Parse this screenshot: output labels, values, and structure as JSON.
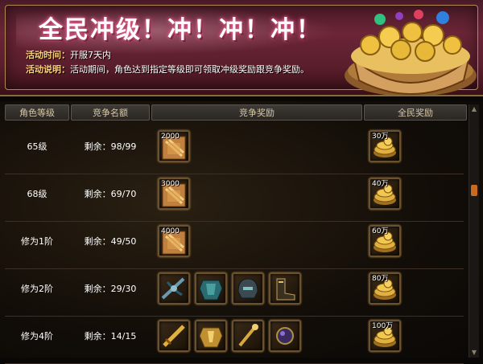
{
  "banner": {
    "title": "全民冲级！冲！冲！冲！",
    "time_key": "活动时间：",
    "time_value": "开服7天内",
    "desc_key": "活动说明：",
    "desc_value": "活动期间，角色达到指定等级即可领取冲级奖励跟竞争奖励。"
  },
  "table": {
    "headers": [
      "角色等级",
      "竞争名额",
      "竞争奖励",
      "全民奖励"
    ],
    "rows": [
      {
        "level": "65级",
        "remain": "剩余：98/99",
        "compete_items": [
          {
            "icon": "gold-tablet-icon",
            "amount": "2000"
          }
        ],
        "all_reward": {
          "icon": "gold-coin-pile-icon",
          "amount": "30万"
        }
      },
      {
        "level": "68级",
        "remain": "剩余：69/70",
        "compete_items": [
          {
            "icon": "gold-tablet-icon",
            "amount": "3000"
          }
        ],
        "all_reward": {
          "icon": "gold-coin-pile-icon",
          "amount": "40万"
        }
      },
      {
        "level": "修为1阶",
        "remain": "剩余：49/50",
        "compete_items": [
          {
            "icon": "gold-tablet-icon",
            "amount": "4000"
          }
        ],
        "all_reward": {
          "icon": "gold-coin-pile-icon",
          "amount": "60万"
        }
      },
      {
        "level": "修为2阶",
        "remain": "剩余：29/30",
        "compete_items": [
          {
            "icon": "crossbow-icon",
            "amount": ""
          },
          {
            "icon": "armor-icon",
            "amount": ""
          },
          {
            "icon": "helmet-icon",
            "amount": ""
          },
          {
            "icon": "boots-icon",
            "amount": ""
          }
        ],
        "all_reward": {
          "icon": "gold-coin-pile-icon",
          "amount": "80万"
        }
      },
      {
        "level": "修为4阶",
        "remain": "剩余：14/15",
        "compete_items": [
          {
            "icon": "golden-weapon-icon",
            "amount": ""
          },
          {
            "icon": "golden-armor-icon",
            "amount": ""
          },
          {
            "icon": "golden-staff-icon",
            "amount": ""
          },
          {
            "icon": "dark-orb-icon",
            "amount": ""
          }
        ],
        "all_reward": {
          "icon": "gold-coin-pile-icon",
          "amount": "100万"
        }
      }
    ]
  },
  "colors": {
    "banner_bg": "#6b2536",
    "accent_gold": "#ffd080",
    "scroll_thumb": "#c86a20"
  }
}
